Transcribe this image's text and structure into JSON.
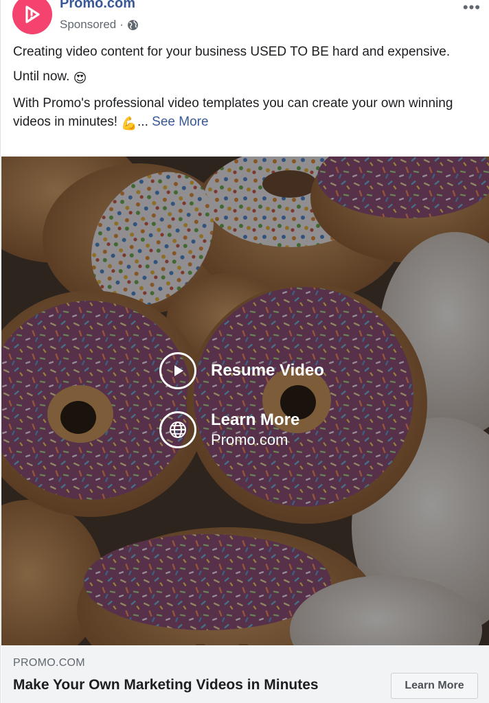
{
  "post": {
    "page_name": "Promo.com",
    "sponsored_label": "Sponsored",
    "meta_separator": "·",
    "privacy_icon": "globe-icon",
    "more_icon": "more-dots-icon",
    "more_glyph": "•••",
    "line1": "Creating video content for your business USED TO BE hard and expensive.",
    "line2_text": "Until now.",
    "line2_emoji": "😍",
    "line3_text": "With Promo's professional video templates you can create your own winning videos in minutes!",
    "line3_emoji": "💪",
    "ellipsis": "...",
    "see_more": "See More"
  },
  "video": {
    "watermark": "Videos",
    "resume_label": "Resume Video",
    "learn_more_label": "Learn More",
    "learn_more_domain": "Promo.com",
    "play_icon": "play-icon",
    "globe_icon": "globe-icon"
  },
  "link": {
    "domain": "PROMO.COM",
    "headline": "Make Your Own Marketing Videos in Minutes",
    "cta_label": "Learn More"
  },
  "colors": {
    "brand_avatar": "#f3436e",
    "link_blue": "#385898",
    "footer_bg": "#f2f3f5"
  }
}
